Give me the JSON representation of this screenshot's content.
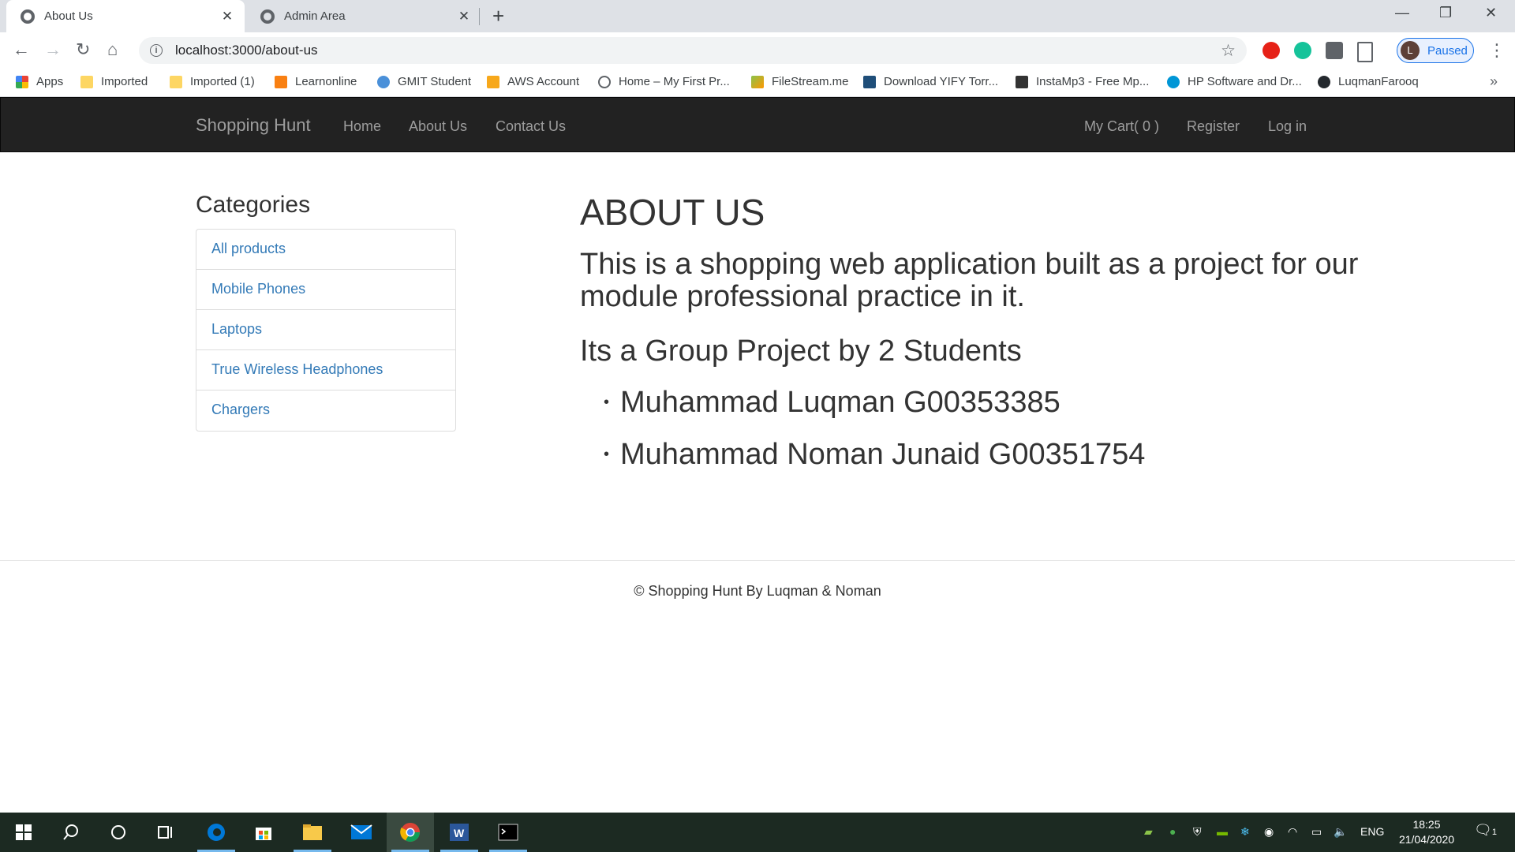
{
  "browser": {
    "tabs": [
      {
        "title": "About Us",
        "close": "✕"
      },
      {
        "title": "Admin Area",
        "close": "✕"
      }
    ],
    "new_tab": "+",
    "window_controls": {
      "minimize": "—",
      "maximize": "❐",
      "close": "✕"
    },
    "url": "localhost:3000/about-us",
    "profile": {
      "initial": "L",
      "status": "Paused"
    },
    "bookmarks": [
      {
        "label": "Apps",
        "icon": "apps-grid-icon"
      },
      {
        "label": "Imported",
        "icon": "folder-icon"
      },
      {
        "label": "Imported (1)",
        "icon": "folder-icon"
      },
      {
        "label": "Learnonline",
        "icon": "moodle-icon"
      },
      {
        "label": "GMIT Student",
        "icon": "gmit-icon"
      },
      {
        "label": "AWS Account",
        "icon": "aws-box-icon"
      },
      {
        "label": "Home – My First Pr...",
        "icon": "gear-icon"
      },
      {
        "label": "FileStream.me",
        "icon": "filestream-icon"
      },
      {
        "label": "Download YIFY Torr...",
        "icon": "film-icon"
      },
      {
        "label": "InstaMp3 - Free Mp...",
        "icon": "instamp3-icon"
      },
      {
        "label": "HP Software and Dr...",
        "icon": "hp-icon"
      },
      {
        "label": "LuqmanFarooq",
        "icon": "github-icon"
      }
    ],
    "bookmarks_more": "»"
  },
  "site": {
    "brand": "Shopping Hunt",
    "nav_left": [
      "Home",
      "About Us",
      "Contact Us"
    ],
    "nav_right": [
      "My Cart( 0 )",
      "Register",
      "Log in"
    ],
    "categories_title": "Categories",
    "categories": [
      "All products",
      "Mobile Phones",
      "Laptops",
      "True Wireless Headphones",
      "Chargers"
    ],
    "about": {
      "title": "ABOUT US",
      "description": "This is a shopping web application built as a project for our module professional practice in it.",
      "group": "Its a Group Project by 2 Students",
      "students": [
        "Muhammad Luqman G00353385",
        "Muhammad Noman Junaid G00351754"
      ]
    },
    "footer": "© Shopping Hunt By Luqman & Noman"
  },
  "taskbar": {
    "language": "ENG",
    "time": "18:25",
    "date": "21/04/2020",
    "notification_count": "1"
  },
  "colors": {
    "navbar_bg": "#222222",
    "navbar_text": "#9d9d9d",
    "link": "#337ab7",
    "taskbar_bg": "#1c2a22"
  }
}
